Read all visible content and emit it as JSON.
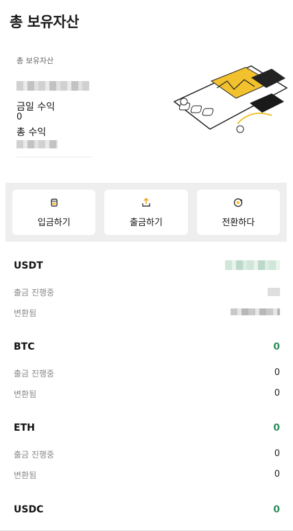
{
  "header": {
    "title": "총 보유자산"
  },
  "summary": {
    "total_label": "총 보유자산",
    "today_profit_label": "금일 수익",
    "today_profit_value": "0",
    "total_profit_label": "총 수익"
  },
  "actions": [
    {
      "label": "입금하기",
      "icon": "deposit-icon"
    },
    {
      "label": "출금하기",
      "icon": "withdraw-icon"
    },
    {
      "label": "전환하다",
      "icon": "convert-icon"
    }
  ],
  "assets": [
    {
      "symbol": "USDT",
      "amount": "",
      "withdrawing_label": "출금 진행중",
      "withdrawing_value": "",
      "converted_label": "변환됨",
      "converted_value": ""
    },
    {
      "symbol": "BTC",
      "amount": "0",
      "withdrawing_label": "출금 진행중",
      "withdrawing_value": "0",
      "converted_label": "변환됨",
      "converted_value": "0"
    },
    {
      "symbol": "ETH",
      "amount": "0",
      "withdrawing_label": "출금 진행중",
      "withdrawing_value": "0",
      "converted_label": "변환됨",
      "converted_value": "0"
    },
    {
      "symbol": "USDC",
      "amount": "0"
    }
  ],
  "colors": {
    "accent_green": "#2f8f5b",
    "illustration_yellow": "#f2c12e",
    "panel_grey": "#eeeeee"
  }
}
